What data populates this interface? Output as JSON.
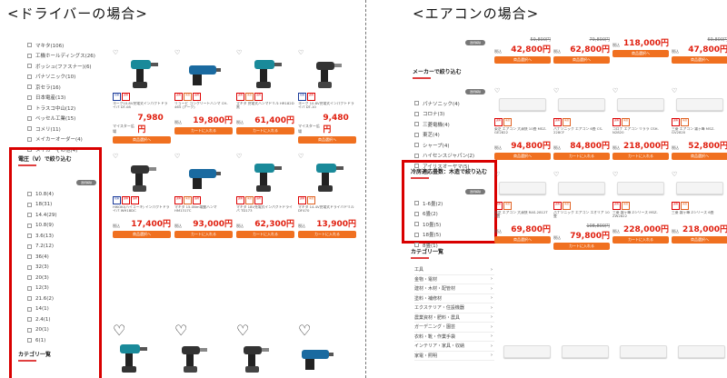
{
  "titles": {
    "left": "<ドライバーの場合>",
    "right": "<エアコンの場合>"
  },
  "left": {
    "brands": [
      "マキタ(106)",
      "工機ホールディングス(26)",
      "ボッシュ(ファスナー)(6)",
      "パナソニック(10)",
      "京セラ(16)",
      "日本電産(13)",
      "トラスコ中山(12)",
      "ベッセル工業(15)",
      "コメリ(11)",
      "メイカーオーダー(4)",
      "メイカーその他(4)"
    ],
    "voltage_title": "電圧（V）で絞り込む",
    "clear_label": "選択解除",
    "voltages": [
      "10.8(4)",
      "18(31)",
      "14.4(29)",
      "10.8(9)",
      "3.6(13)",
      "7.2(12)",
      "36(4)",
      "32(3)",
      "20(3)",
      "12(3)",
      "21.6(2)",
      "14(1)",
      "2.4(1)",
      "20(1)",
      "6(1)"
    ],
    "category_title": "カテゴリ一覧",
    "products": [
      {
        "name": "ヨーク10.8V充電式インパクトドライバ DT-08",
        "badges": [
          "在庫",
          "送料"
        ],
        "label": "マイスター広場",
        "price": "7,980円",
        "btn": "商品選択へ",
        "shape": "drill"
      },
      {
        "name": "リョービ コンクリートハンマ CH-465 (アーク)",
        "badges": [
          "送料",
          "当日",
          "出荷"
        ],
        "label": "税込",
        "price": "19,800円",
        "btn": "カートに入れる",
        "shape": "hammer"
      },
      {
        "name": "マキタ 充電式ハンマドリル HR182D 黒",
        "badges": [
          "送料",
          "当日",
          "出荷"
        ],
        "label": "税込",
        "price": "61,400円",
        "btn": "カートに入れる",
        "shape": "drill"
      },
      {
        "name": "ヨーク 10.8V充電式インパクトドライバ DT-10",
        "badges": [
          "在庫",
          "送料"
        ],
        "label": "マイスター広場",
        "price": "9,480円",
        "btn": "商品選択へ",
        "shape": "impact"
      },
      {
        "name": "HiKOKI(ハイコーキ) インパクトドライバ WH18DC",
        "badges": [
          "在庫",
          "送料",
          "出荷"
        ],
        "label": "税込",
        "price": "17,400円",
        "btn": "商品選択へ",
        "shape": "impact"
      },
      {
        "name": "マキタ 15.0Nm電動ハンマ HM1317C",
        "badges": [
          "送料",
          "当日",
          "出荷"
        ],
        "label": "税込",
        "price": "93,000円",
        "btn": "カートに入れる",
        "shape": "hammer"
      },
      {
        "name": "マキタ 18V充電式インパクトドライバ TD173",
        "badges": [
          "送料",
          "当日",
          "出荷"
        ],
        "label": "税込",
        "price": "62,300円",
        "btn": "カートに入れる",
        "shape": "drill"
      },
      {
        "name": "マキタ 14.4V充電式ドライバドリル DF470",
        "badges": [
          "送料",
          "当日"
        ],
        "label": "税込",
        "price": "13,900円",
        "btn": "カートに入れる",
        "shape": "drill"
      }
    ]
  },
  "right": {
    "filter_title_maker": "メーカーで絞り込む",
    "makers": [
      "パナソニック(4)",
      "コロナ(3)",
      "三菱電機(4)",
      "東芝(4)",
      "シャープ(4)",
      "ハイセンスジャパン(2)",
      "アイリスオーヤマ(5)"
    ],
    "clear_label": "選択解除",
    "area_title": "冷房適応畳数：木造で絞り込む",
    "areas": [
      "1-6畳(2)",
      "6畳(2)",
      "10畳(5)",
      "18畳(5)",
      "8畳(1)"
    ],
    "category_title": "カテゴリ一覧",
    "categories": [
      "工具",
      "金物・電材",
      "建材・木材・配管材",
      "塗料・補修材",
      "エクステリア・住設機器",
      "農業資材・肥料・農具",
      "ガーデニング・園芸",
      "衣料・靴・作業手袋",
      "インテリア・家具・収納",
      "家電・照明"
    ],
    "top_prices": [
      {
        "old": "59,800円",
        "price": "42,800円"
      },
      {
        "old": "79,800円",
        "price": "62,800円"
      },
      {
        "old": "",
        "price": "118,000円"
      },
      {
        "old": "69,800円",
        "price": "47,800円"
      }
    ],
    "rows": [
      [
        {
          "name": "東芝 エアコン 大清快 10畳 MSZ-GE2822",
          "price": "94,800円"
        },
        {
          "name": "パナソニック エアコン 6畳 CS-228CF",
          "price": "84,800円"
        },
        {
          "name": "コロナ エアコン リララ CSH-N2820",
          "price": "218,000円"
        },
        {
          "name": "三菱 エアコン 霧ヶ峰 MSZ-GV2820",
          "price": "52,800円"
        }
      ],
      [
        {
          "name": "東芝 エアコン 大清快 RAS-2812T 6畳",
          "price": "69,800円",
          "old": ""
        },
        {
          "name": "パナソニック エアコン エオリア 10畳",
          "price": "79,800円",
          "old": "108,800円"
        },
        {
          "name": "三菱 霧ヶ峰 Zシリーズ MSZ-ZW2822",
          "price": "228,000円"
        },
        {
          "name": "三菱 霧ヶ峰 Zシリーズ 6畳",
          "price": "218,000円"
        }
      ]
    ],
    "btn_select": "商品選択へ",
    "btn_cart": "カートに入れる",
    "label_tax": "税込"
  }
}
